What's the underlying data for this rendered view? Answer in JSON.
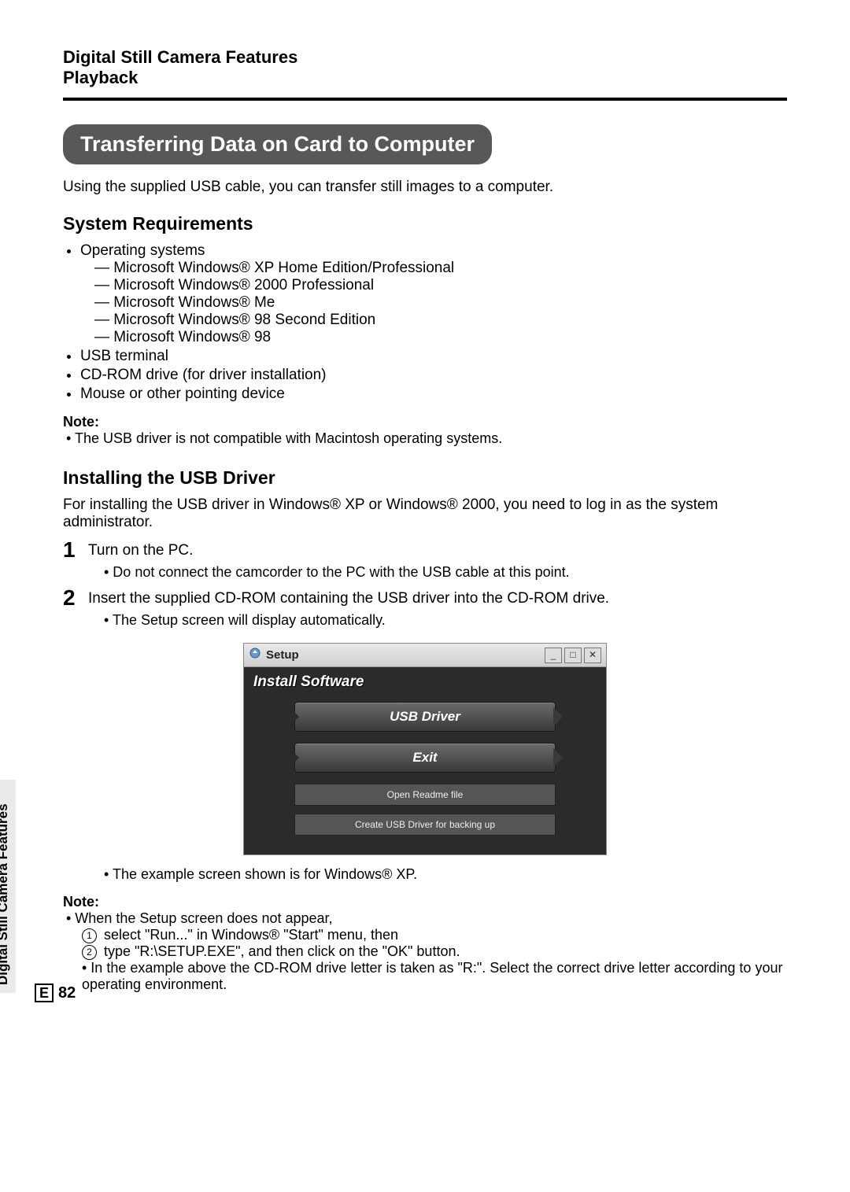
{
  "header": {
    "line1": "Digital Still Camera Features",
    "line2": "Playback"
  },
  "title": "Transferring Data on Card to Computer",
  "intro": "Using the supplied USB cable, you can transfer still images to a computer.",
  "sysreq": {
    "heading": "System Requirements",
    "os_label": "Operating systems",
    "os_list": [
      "— Microsoft Windows® XP Home Edition/Professional",
      "— Microsoft Windows® 2000 Professional",
      "— Microsoft Windows® Me",
      "— Microsoft Windows® 98 Second Edition",
      "— Microsoft Windows® 98"
    ],
    "other": [
      "USB terminal",
      "CD-ROM drive (for driver installation)",
      "Mouse or other pointing device"
    ],
    "note_label": "Note:",
    "note_text": "• The USB driver is not compatible with Macintosh operating systems."
  },
  "install": {
    "heading": "Installing the USB Driver",
    "intro": "For installing the USB driver in Windows® XP or Windows® 2000, you need to log in as the system administrator.",
    "steps": [
      {
        "num": "1",
        "text": "Turn on the PC.",
        "subs": [
          "• Do not connect the camcorder to the PC with the USB cable at this point."
        ]
      },
      {
        "num": "2",
        "text": "Insert the supplied CD-ROM containing the USB driver into the CD-ROM drive.",
        "subs": [
          "• The Setup screen will display automatically."
        ]
      }
    ],
    "after_window": "• The example screen shown is for Windows® XP.",
    "note_label": "Note:",
    "note_lines": [
      "• When the Setup screen does not appear,",
      {
        "circ": "1",
        "text": " select \"Run...\" in Windows® \"Start\" menu, then"
      },
      {
        "circ": "2",
        "text": " type \"R:\\SETUP.EXE\", and then click on the \"OK\" button."
      },
      "• In the example above the CD-ROM drive letter is taken as \"R:\". Select the correct drive letter according to your operating environment."
    ]
  },
  "setup_window": {
    "title": "Setup",
    "install_label": "Install Software",
    "btn_usb": "USB Driver",
    "btn_exit": "Exit",
    "btn_readme": "Open Readme file",
    "btn_backup": "Create USB Driver for backing up"
  },
  "side_tab": "Digital Still Camera Features",
  "page_letter": "E",
  "page_number": "82"
}
